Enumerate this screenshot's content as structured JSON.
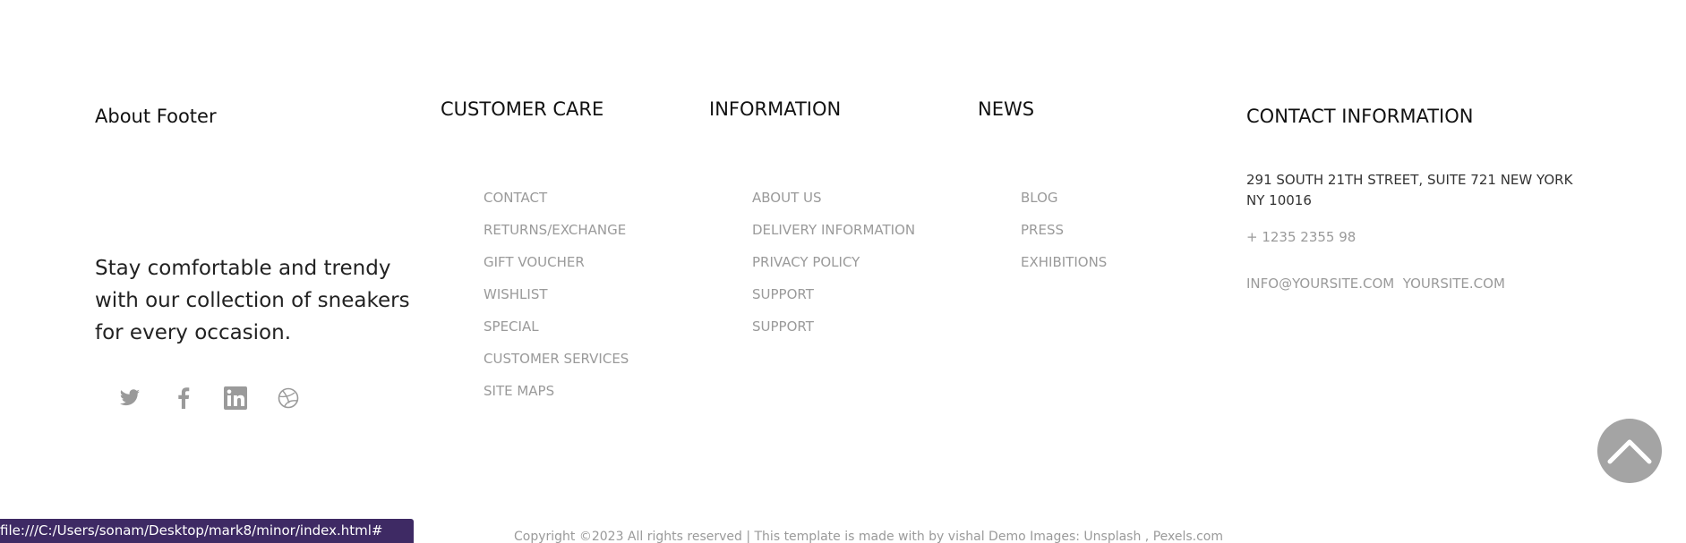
{
  "footer": {
    "about": {
      "title": "About Footer",
      "description": "Stay comfortable and trendy with our collection of sneakers for every occasion.",
      "social_icons": [
        "twitter-icon",
        "facebook-icon",
        "linkedin-icon",
        "dribbble-icon"
      ]
    },
    "customer_care": {
      "title": "CUSTOMER CARE",
      "links": [
        "CONTACT",
        "RETURNS/EXCHANGE",
        "GIFT VOUCHER",
        "WISHLIST",
        "SPECIAL",
        "CUSTOMER SERVICES",
        "SITE MAPS"
      ]
    },
    "information": {
      "title": "INFORMATION",
      "links": [
        "ABOUT US",
        "DELIVERY INFORMATION",
        "PRIVACY POLICY",
        "SUPPORT",
        "SUPPORT"
      ]
    },
    "news": {
      "title": "NEWS",
      "links": [
        "BLOG",
        "PRESS",
        "EXHIBITIONS"
      ]
    },
    "contact": {
      "title": "CONTACT INFORMATION",
      "address": "291 SOUTH 21TH STREET, SUITE 721 NEW YORK NY 10016",
      "phone": "+ 1235 2355 98",
      "email": "INFO@YOURSITE.COM",
      "website": "YOURSITE.COM"
    },
    "copyright": "Copyright ©2023 All rights reserved | This template is made with by vishal Demo Images: Unsplash , Pexels.com"
  },
  "scroll_top_icon": "chevron-up-icon",
  "status_bar": {
    "url": "file:///C:/Users/sonam/Desktop/mark8/minor/index.html#"
  },
  "colors": {
    "heading": "#111111",
    "link": "#9a9a9a",
    "scroll_button": "#a4a4a4",
    "status_bar_bg": "#3e2a64"
  }
}
